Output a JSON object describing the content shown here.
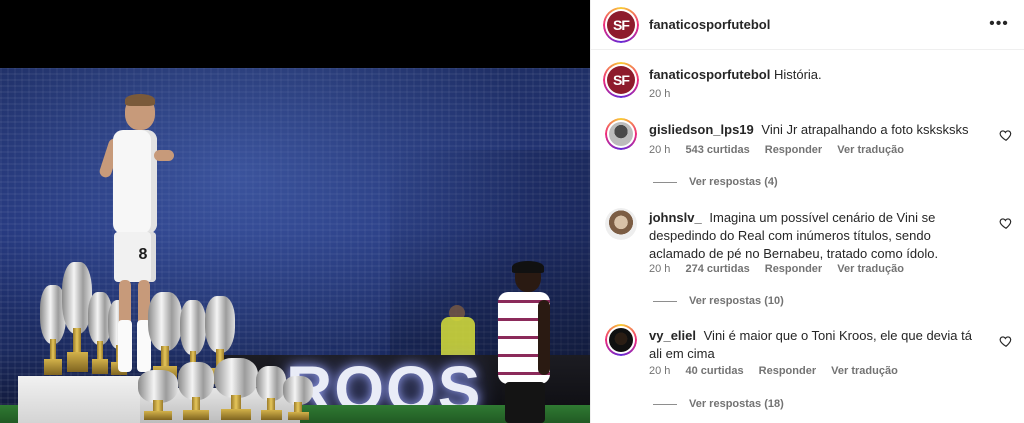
{
  "post": {
    "author": "fanaticosporfutebol",
    "avatar_initials": "SF",
    "caption": "História.",
    "caption_time": "20 h",
    "photo": {
      "board_text": "ROOS",
      "shirt_number": "8"
    }
  },
  "header": {
    "username": "fanaticosporfutebol",
    "more_label": "•••"
  },
  "comments": [
    {
      "username": "gisliedson_lps19",
      "text": "Vini Jr atrapalhando a foto ksksksks",
      "time": "20 h",
      "likes": "543 curtidas",
      "reply": "Responder",
      "translate": "Ver tradução",
      "replies": "Ver respostas (4)"
    },
    {
      "username": "johnslv_",
      "text": "Imagina um possível cenário de Vini se despedindo do Real com inúmeros títulos, sendo aclamado de pé no Bernabeu, tratado como ídolo.",
      "time": "20 h",
      "likes": "274 curtidas",
      "reply": "Responder",
      "translate": "Ver tradução",
      "replies": "Ver respostas (10)"
    },
    {
      "username": "vy_eliel",
      "text": "Vini é maior que o Toni Kroos, ele que devia tá ali em cima",
      "time": "20 h",
      "likes": "40 curtidas",
      "reply": "Responder",
      "translate": "Ver tradução",
      "replies": "Ver respostas (18)"
    }
  ],
  "colors": {
    "brand_avatar": "#8e1b2c",
    "secondary_text": "#737373",
    "primary_text": "#262626"
  }
}
